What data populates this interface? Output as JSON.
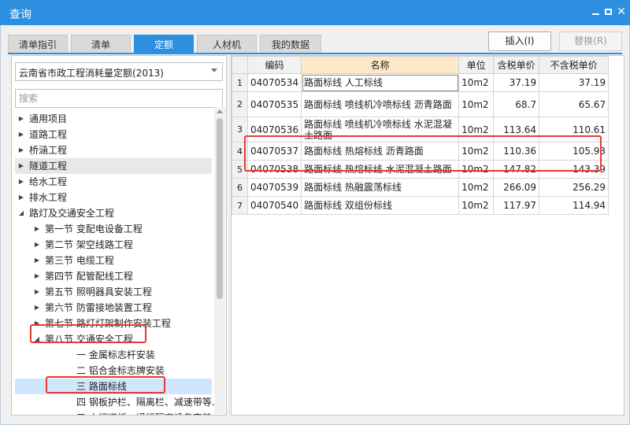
{
  "window": {
    "title": "查询",
    "accent": "#2d8fe0",
    "highlight": "#e53935"
  },
  "tabs": [
    {
      "label": "清单指引",
      "active": false
    },
    {
      "label": "清单",
      "active": false
    },
    {
      "label": "定额",
      "active": true
    },
    {
      "label": "人材机",
      "active": false
    },
    {
      "label": "我的数据",
      "active": false
    }
  ],
  "actions": {
    "insert": "插入(I)",
    "replace": "替换(R)"
  },
  "left": {
    "library": "云南省市政工程消耗量定额(2013)",
    "search_placeholder": "搜索",
    "tree": [
      {
        "label": "通用项目",
        "level": 0,
        "state": "collapsed"
      },
      {
        "label": "道路工程",
        "level": 0,
        "state": "collapsed"
      },
      {
        "label": "桥涵工程",
        "level": 0,
        "state": "collapsed"
      },
      {
        "label": "隧道工程",
        "level": 0,
        "state": "collapsed"
      },
      {
        "label": "给水工程",
        "level": 0,
        "state": "collapsed"
      },
      {
        "label": "排水工程",
        "level": 0,
        "state": "collapsed"
      },
      {
        "label": "路灯及交通安全工程",
        "level": 0,
        "state": "expanded"
      },
      {
        "label": "第一节 变配电设备工程",
        "level": 1,
        "state": "collapsed"
      },
      {
        "label": "第二节 架空线路工程",
        "level": 1,
        "state": "collapsed"
      },
      {
        "label": "第三节 电缆工程",
        "level": 1,
        "state": "collapsed"
      },
      {
        "label": "第四节 配管配线工程",
        "level": 1,
        "state": "collapsed"
      },
      {
        "label": "第五节 照明器具安装工程",
        "level": 1,
        "state": "collapsed"
      },
      {
        "label": "第六节 防雷接地装置工程",
        "level": 1,
        "state": "collapsed"
      },
      {
        "label": "第七节 路灯灯架制作安装工程",
        "level": 1,
        "state": "collapsed"
      },
      {
        "label": "第八节 交通安全工程",
        "level": 1,
        "state": "expanded"
      },
      {
        "label": "一 金属标志杆安装",
        "level": 2,
        "state": "leaf"
      },
      {
        "label": "二 铝合金标志牌安装",
        "level": 2,
        "state": "leaf"
      },
      {
        "label": "三 路面标线",
        "level": 2,
        "state": "leaf",
        "selected": true
      },
      {
        "label": "四 钢板护栏、隔离栏、减速带等...",
        "level": 2,
        "state": "leaf"
      },
      {
        "label": "五 人行道板、通行隔离设备安装",
        "level": 2,
        "state": "leaf"
      }
    ]
  },
  "grid": {
    "columns": [
      "编码",
      "名称",
      "单位",
      "含税单价",
      "不含税单价"
    ],
    "rows": [
      {
        "no": "1",
        "code": "04070534",
        "name": "路面标线 人工标线",
        "unit": "10m2",
        "price_tax": "37.19",
        "price_notax": "37.19"
      },
      {
        "no": "2",
        "code": "04070535",
        "name": "路面标线 喷线机冷喷标线 沥青路面",
        "unit": "10m2",
        "price_tax": "68.7",
        "price_notax": "65.67"
      },
      {
        "no": "3",
        "code": "04070536",
        "name": "路面标线 喷线机冷喷标线 水泥混凝土路面",
        "unit": "10m2",
        "price_tax": "113.64",
        "price_notax": "110.61"
      },
      {
        "no": "4",
        "code": "04070537",
        "name": "路面标线 热熔标线 沥青路面",
        "unit": "10m2",
        "price_tax": "110.36",
        "price_notax": "105.93"
      },
      {
        "no": "5",
        "code": "04070538",
        "name": "路面标线 热熔标线 水泥混凝土路面",
        "unit": "10m2",
        "price_tax": "147.82",
        "price_notax": "143.39"
      },
      {
        "no": "6",
        "code": "04070539",
        "name": "路面标线 热融震荡标线",
        "unit": "10m2",
        "price_tax": "266.09",
        "price_notax": "256.29"
      },
      {
        "no": "7",
        "code": "04070540",
        "name": "路面标线 双组份标线",
        "unit": "10m2",
        "price_tax": "117.97",
        "price_notax": "114.94"
      }
    ]
  }
}
